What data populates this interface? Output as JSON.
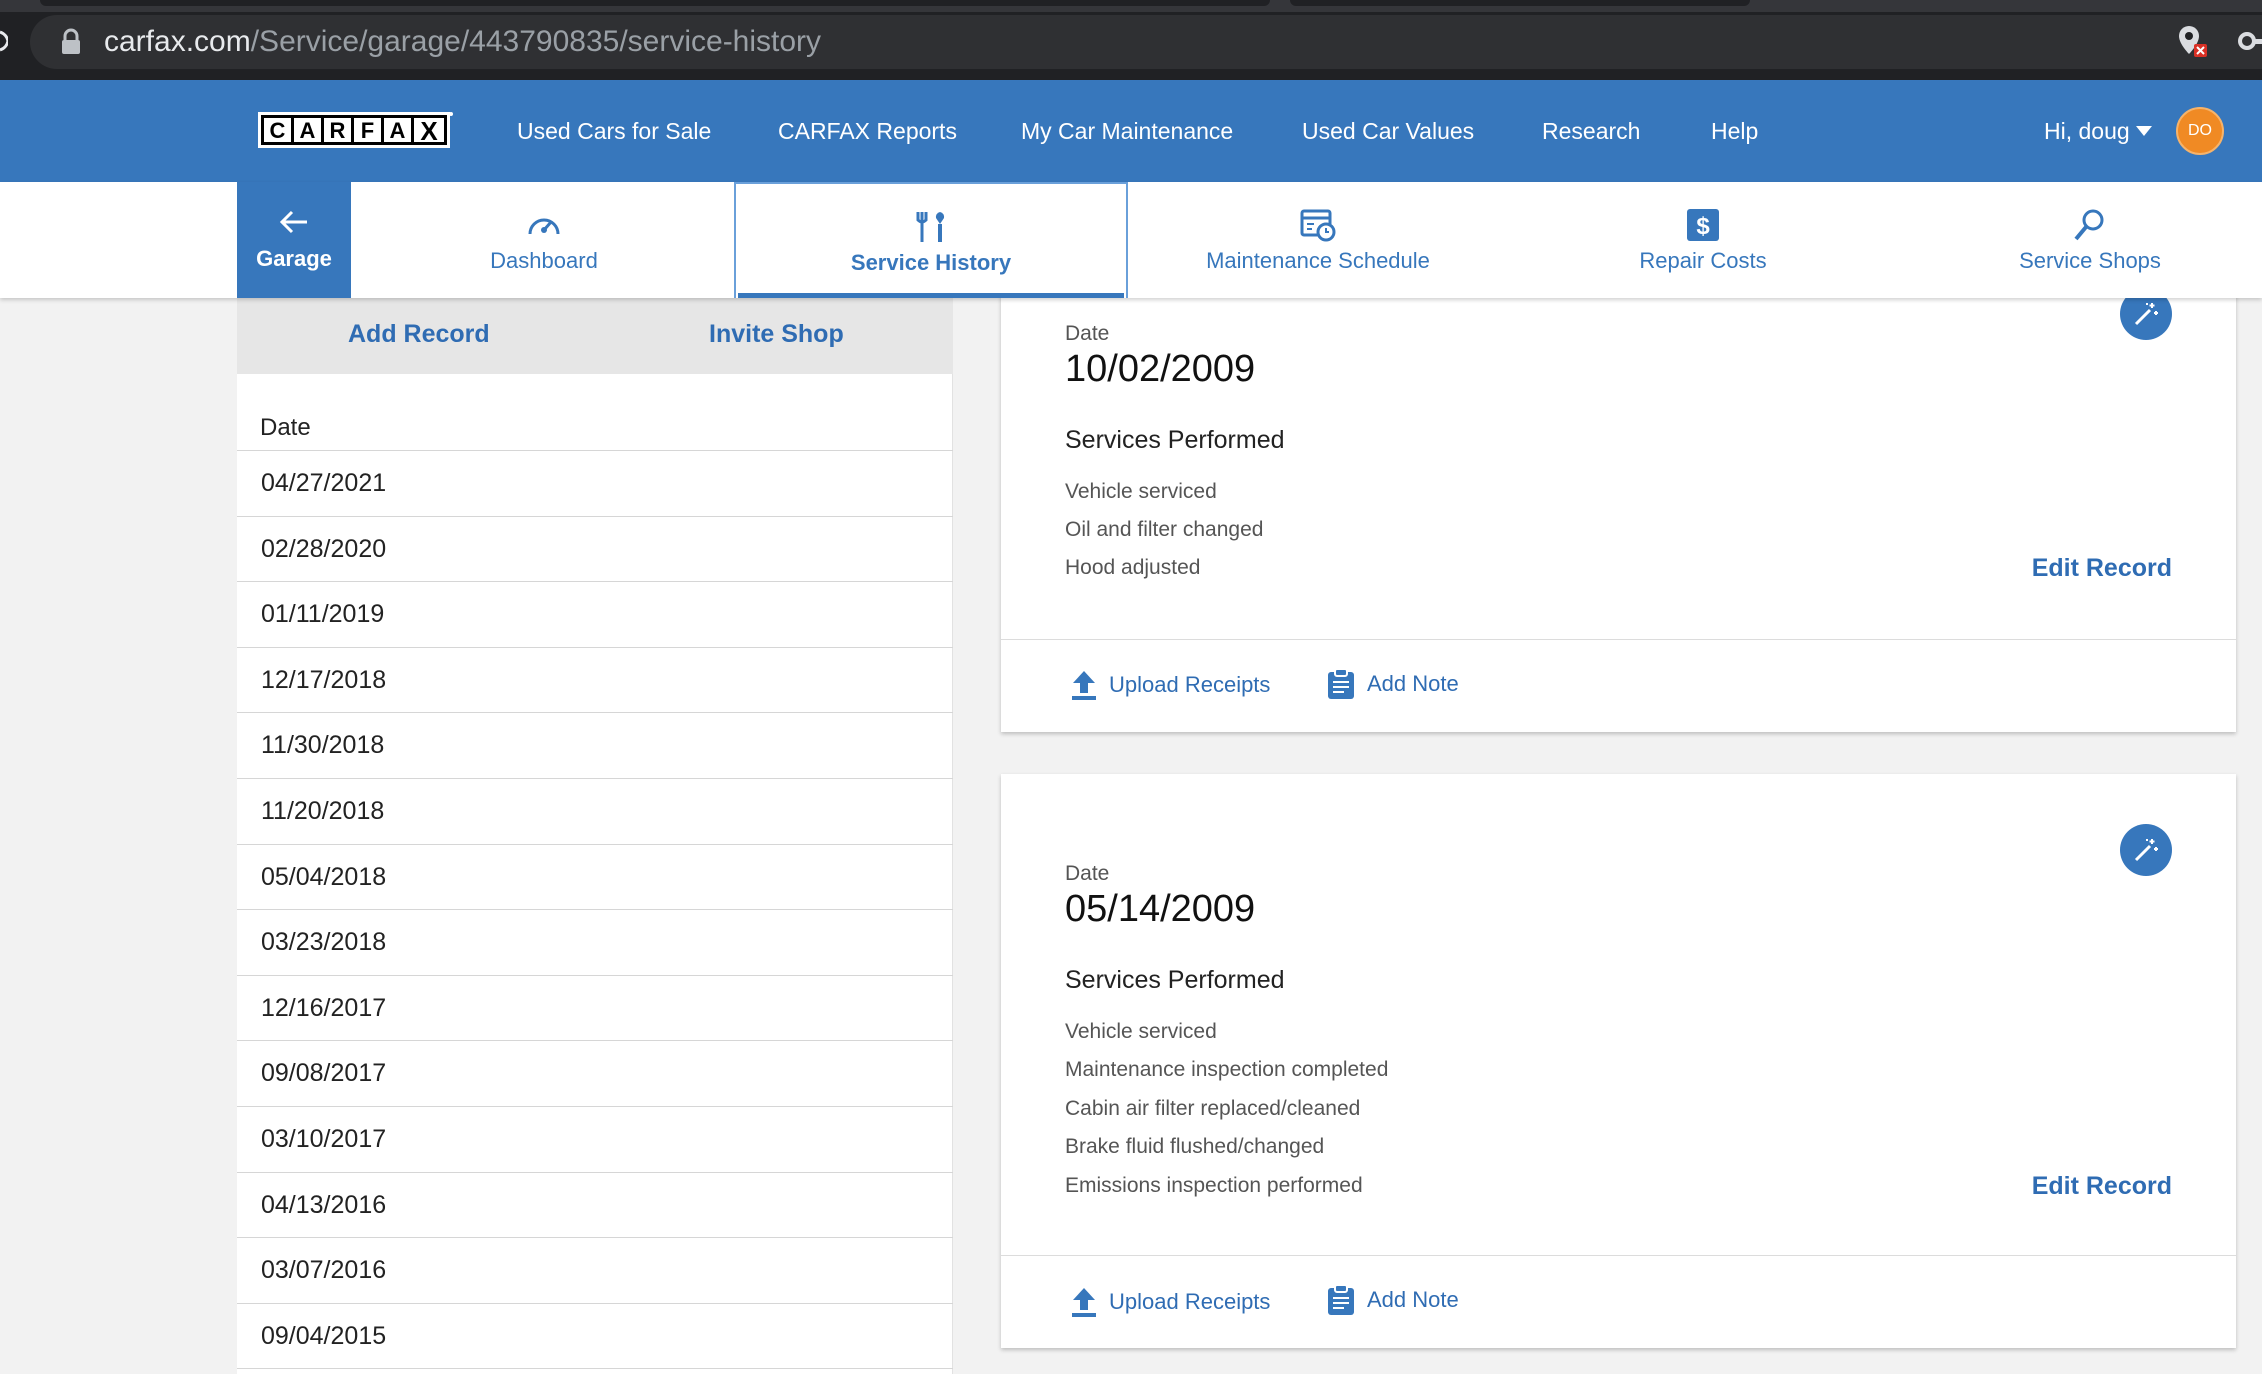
{
  "browser": {
    "url_host": "carfax.com",
    "url_path": "/Service/garage/443790835/service-history"
  },
  "header": {
    "logo_text": "CARFAX",
    "nav": [
      {
        "label": "Used Cars for Sale"
      },
      {
        "label": "CARFAX Reports"
      },
      {
        "label": "My Car Maintenance"
      },
      {
        "label": "Used Car Values"
      },
      {
        "label": "Research"
      },
      {
        "label": "Help"
      }
    ],
    "greeting": "Hi, doug",
    "avatar_initials": "DO"
  },
  "subnav": {
    "garage_label": "Garage",
    "tabs": [
      {
        "label": "Dashboard",
        "icon": "speedometer-icon"
      },
      {
        "label": "Service History",
        "icon": "tools-icon",
        "active": true
      },
      {
        "label": "Maintenance Schedule",
        "icon": "calendar-clock-icon"
      },
      {
        "label": "Repair Costs",
        "icon": "dollar-icon"
      },
      {
        "label": "Service Shops",
        "icon": "magnifier-icon"
      }
    ]
  },
  "sidebar": {
    "add_record": "Add Record",
    "invite_shop": "Invite Shop",
    "date_header": "Date",
    "dates": [
      "04/27/2021",
      "02/28/2020",
      "01/11/2019",
      "12/17/2018",
      "11/30/2018",
      "11/20/2018",
      "05/04/2018",
      "03/23/2018",
      "12/16/2017",
      "09/08/2017",
      "03/10/2017",
      "04/13/2016",
      "03/07/2016",
      "09/04/2015"
    ]
  },
  "records": [
    {
      "date_label": "Date",
      "date": "10/02/2009",
      "services_title": "Services Performed",
      "services": [
        "Vehicle serviced",
        "Oil and filter changed",
        "Hood adjusted"
      ],
      "edit_label": "Edit Record",
      "upload_label": "Upload Receipts",
      "note_label": "Add Note"
    },
    {
      "date_label": "Date",
      "date": "05/14/2009",
      "services_title": "Services Performed",
      "services": [
        "Vehicle serviced",
        "Maintenance inspection completed",
        "Cabin air filter replaced/cleaned",
        "Brake fluid flushed/changed",
        "Emissions inspection performed"
      ],
      "edit_label": "Edit Record",
      "upload_label": "Upload Receipts",
      "note_label": "Add Note"
    }
  ],
  "colors": {
    "brand_blue": "#3777bc",
    "link_blue": "#2f6cb3",
    "avatar_orange": "#f08a24"
  }
}
